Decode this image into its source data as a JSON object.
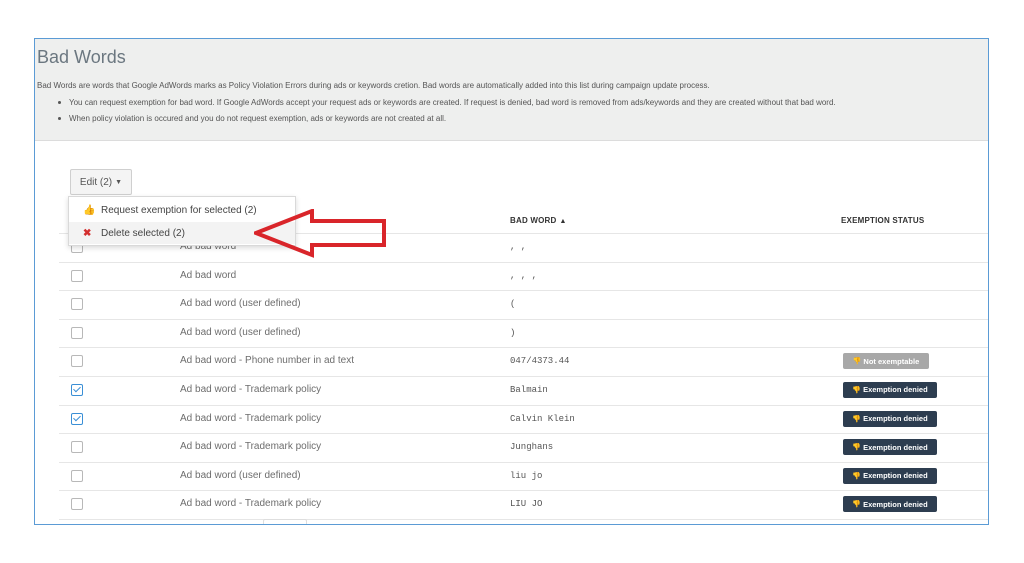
{
  "page": {
    "title": "Bad Words",
    "description": "Bad Words are words that Google AdWords marks as Policy Violation Errors during ads or keywords cretion. Bad words are automatically added into this list during campaign update process.",
    "bullets": [
      "You can request exemption for bad word. If Google AdWords accept your request ads or keywords are created. If request is denied, bad word is removed from ads/keywords and they are created without that bad word.",
      "When policy violation is occured and you do not request exemption, ads or keywords are not created at all."
    ]
  },
  "toolbar": {
    "edit_label": "Edit (2)",
    "edit_caret": "▼"
  },
  "dropdown": {
    "request_label": "Request exemption for selected (2)",
    "request_icon": "thumbs-up-icon",
    "delete_label": "Delete selected (2)",
    "delete_icon": "x-icon"
  },
  "table": {
    "columns": {
      "bad_word": "BAD WORD",
      "bad_word_sort": "▲",
      "exemption_status": "EXEMPTION STATUS"
    },
    "rows": [
      {
        "checked": false,
        "type": "Ad bad word",
        "word": ", ,",
        "status": ""
      },
      {
        "checked": false,
        "type": "Ad bad word",
        "word": ", , ,",
        "status": ""
      },
      {
        "checked": false,
        "type": "Ad bad word (user defined)",
        "word": "(",
        "status": ""
      },
      {
        "checked": false,
        "type": "Ad bad word (user defined)",
        "word": ")",
        "status": ""
      },
      {
        "checked": false,
        "type": "Ad bad word - Phone number in ad text",
        "word": "047/4373.44",
        "status": "Not exemptable"
      },
      {
        "checked": true,
        "type": "Ad bad word - Trademark policy",
        "word": "Balmain",
        "status": "Exemption denied"
      },
      {
        "checked": true,
        "type": "Ad bad word - Trademark policy",
        "word": "Calvin Klein",
        "status": "Exemption denied"
      },
      {
        "checked": false,
        "type": "Ad bad word - Trademark policy",
        "word": "Junghans",
        "status": "Exemption denied"
      },
      {
        "checked": false,
        "type": "Ad bad word (user defined)",
        "word": "liu jo",
        "status": "Exemption denied"
      },
      {
        "checked": false,
        "type": "Ad bad word - Trademark policy",
        "word": "LIU JO",
        "status": "Exemption denied"
      }
    ]
  },
  "colors": {
    "frame_border": "#5b9bd5",
    "header_bg": "#eeefee",
    "badge_denied": "#2d3d50",
    "badge_not_exemptable": "#a8a8a8",
    "annotation_arrow": "#d9252a",
    "checkbox_checked": "#3a8fd6"
  }
}
